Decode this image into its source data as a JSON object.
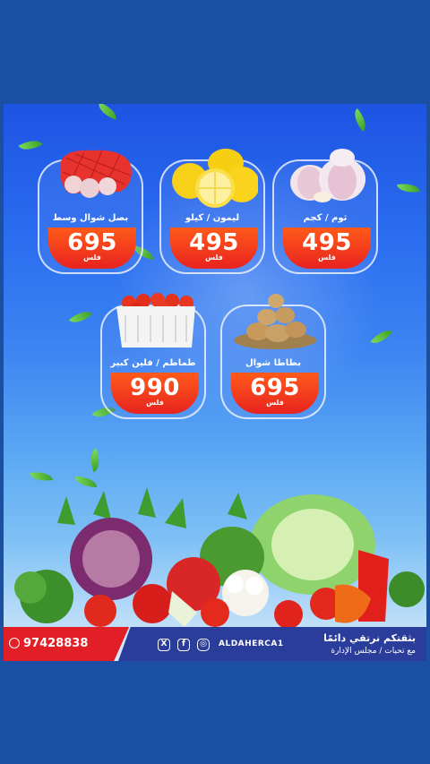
{
  "products": [
    {
      "name": "ثوم / كجم",
      "price": "495",
      "currency": "فلس",
      "image": "garlic"
    },
    {
      "name": "ليمون / كيلو",
      "price": "495",
      "currency": "فلس",
      "image": "lemons"
    },
    {
      "name": "بصل شوال وسط",
      "price": "695",
      "currency": "فلس",
      "image": "onion-sack"
    },
    {
      "name": "بطاطا شوال",
      "price": "695",
      "currency": "فلس",
      "image": "potatoes"
    },
    {
      "name": "طماطم / فلين كبير",
      "price": "990",
      "currency": "فلس",
      "image": "tomato-box"
    }
  ],
  "footer": {
    "phone": "97428838",
    "handle": "ALDAHERCA1",
    "slogan": "بثقتكم نرتقي دائمًا",
    "regards": "مع تحيات / مجلس الإدارة"
  },
  "icons": [
    "whatsapp-icon",
    "x-icon",
    "facebook-icon",
    "instagram-icon"
  ],
  "colors": {
    "background": "#1a4fa3",
    "price_tag": "#e8231f",
    "footer_red": "#e21e26",
    "footer_blue": "#2a3d9a"
  }
}
